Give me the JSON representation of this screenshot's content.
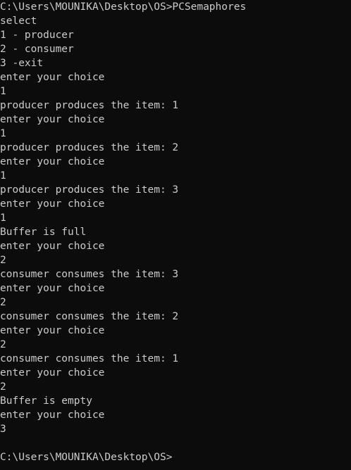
{
  "terminal": {
    "lines": [
      "C:\\Users\\MOUNIKA\\Desktop\\OS>PCSemaphores",
      "select",
      "1 - producer",
      "2 - consumer",
      "3 -exit",
      "enter your choice",
      "1",
      "producer produces the item: 1",
      "enter your choice",
      "1",
      "producer produces the item: 2",
      "enter your choice",
      "1",
      "producer produces the item: 3",
      "enter your choice",
      "1",
      "Buffer is full",
      "enter your choice",
      "2",
      "consumer consumes the item: 3",
      "enter your choice",
      "2",
      "consumer consumes the item: 2",
      "enter your choice",
      "2",
      "consumer consumes the item: 1",
      "enter your choice",
      "2",
      "Buffer is empty",
      "enter your choice",
      "3",
      "",
      "C:\\Users\\MOUNIKA\\Desktop\\OS>"
    ],
    "colors": {
      "background": "#0c0c0c",
      "foreground": "#cccccc"
    }
  }
}
